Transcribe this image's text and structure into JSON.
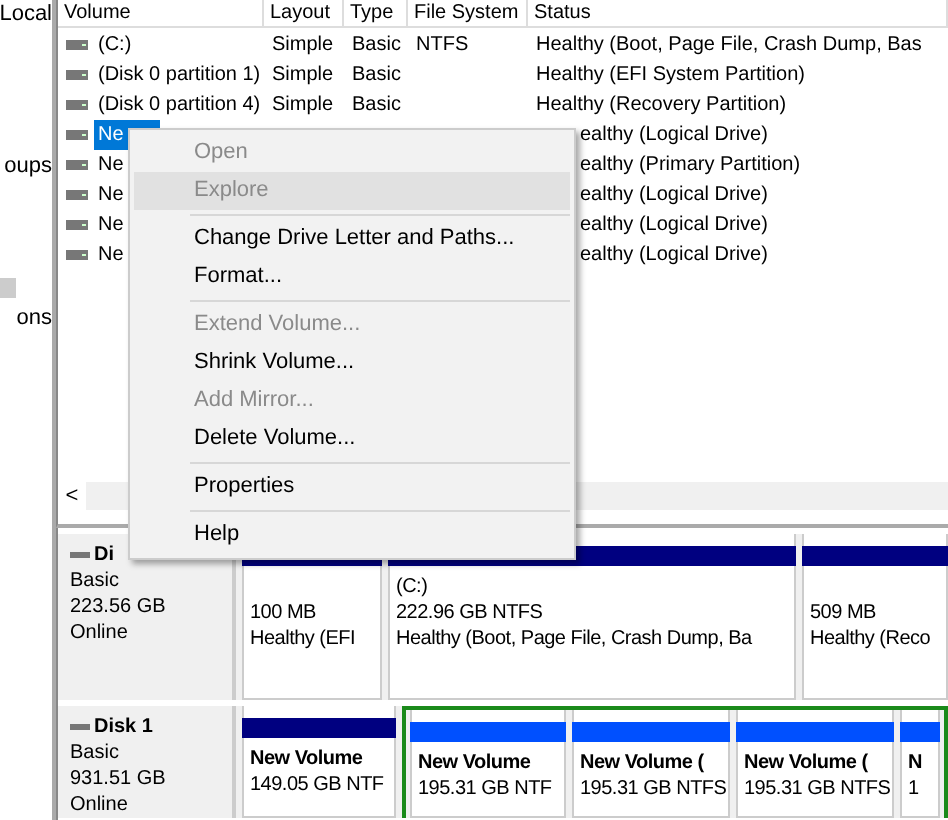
{
  "left_pane": {
    "labels": [
      "Local",
      "oups",
      "ons"
    ]
  },
  "volume_table": {
    "columns": [
      "Volume",
      "Layout",
      "Type",
      "File System",
      "Status"
    ],
    "rows": [
      {
        "name": "(C:)",
        "layout": "Simple",
        "type": "Basic",
        "file_system": "NTFS",
        "status": "Healthy (Boot, Page File, Crash Dump, Bas"
      },
      {
        "name": "(Disk 0 partition 1)",
        "layout": "Simple",
        "type": "Basic",
        "file_system": "",
        "status": "Healthy (EFI System Partition)"
      },
      {
        "name": "(Disk 0 partition 4)",
        "layout": "Simple",
        "type": "Basic",
        "file_system": "",
        "status": "Healthy (Recovery Partition)"
      }
    ],
    "rows_behind_menu": [
      {
        "name": "Ne",
        "status": "ealthy (Logical Drive)",
        "selected": true
      },
      {
        "name": "Ne",
        "status": "ealthy (Primary Partition)",
        "selected": false
      },
      {
        "name": "Ne",
        "status": "ealthy (Logical Drive)",
        "selected": false
      },
      {
        "name": "Ne",
        "status": "ealthy (Logical Drive)",
        "selected": false
      },
      {
        "name": "Ne",
        "status": "ealthy (Logical Drive)",
        "selected": false
      }
    ],
    "scroll_left": "<"
  },
  "context_menu": {
    "items": [
      {
        "kind": "item",
        "label": "Open",
        "disabled": true,
        "selected": false
      },
      {
        "kind": "item",
        "label": "Explore",
        "disabled": true,
        "selected": true
      },
      {
        "kind": "separator"
      },
      {
        "kind": "item",
        "label": "Change Drive Letter and Paths...",
        "disabled": false,
        "selected": false
      },
      {
        "kind": "item",
        "label": "Format...",
        "disabled": false,
        "selected": false
      },
      {
        "kind": "separator"
      },
      {
        "kind": "item",
        "label": "Extend Volume...",
        "disabled": true,
        "selected": false
      },
      {
        "kind": "item",
        "label": "Shrink Volume...",
        "disabled": false,
        "selected": false
      },
      {
        "kind": "item",
        "label": "Add Mirror...",
        "disabled": true,
        "selected": false
      },
      {
        "kind": "item",
        "label": "Delete Volume...",
        "disabled": false,
        "selected": false
      },
      {
        "kind": "separator"
      },
      {
        "kind": "item",
        "label": "Properties",
        "disabled": false,
        "selected": false
      },
      {
        "kind": "separator"
      },
      {
        "kind": "item",
        "label": "Help",
        "disabled": false,
        "selected": false
      }
    ]
  },
  "disks": [
    {
      "name": "Di",
      "type": "Basic",
      "size": "223.56 GB",
      "status": "Online",
      "partitions": [
        {
          "kind": "primary",
          "size": "100 MB",
          "status": "Healthy (EFI"
        },
        {
          "kind": "primary",
          "name": "(C:)",
          "size": "222.96 GB NTFS",
          "status": "Healthy (Boot, Page File, Crash Dump, Ba"
        },
        {
          "kind": "primary",
          "size": "509 MB",
          "status": "Healthy (Reco"
        }
      ]
    },
    {
      "name": "Disk 1",
      "type": "Basic",
      "size": "931.51 GB",
      "status": "Online",
      "partitions": [
        {
          "kind": "primary",
          "name": "New Volume",
          "size": "149.05 GB NTF"
        },
        {
          "kind": "logical",
          "name": "New Volume",
          "size": "195.31 GB NTF"
        },
        {
          "kind": "logical",
          "name": "New Volume (",
          "size": "195.31 GB NTFS"
        },
        {
          "kind": "logical",
          "name": "New Volume (",
          "size": "195.31 GB NTFS"
        },
        {
          "kind": "logical",
          "name": "N",
          "size": "1"
        }
      ]
    }
  ]
}
